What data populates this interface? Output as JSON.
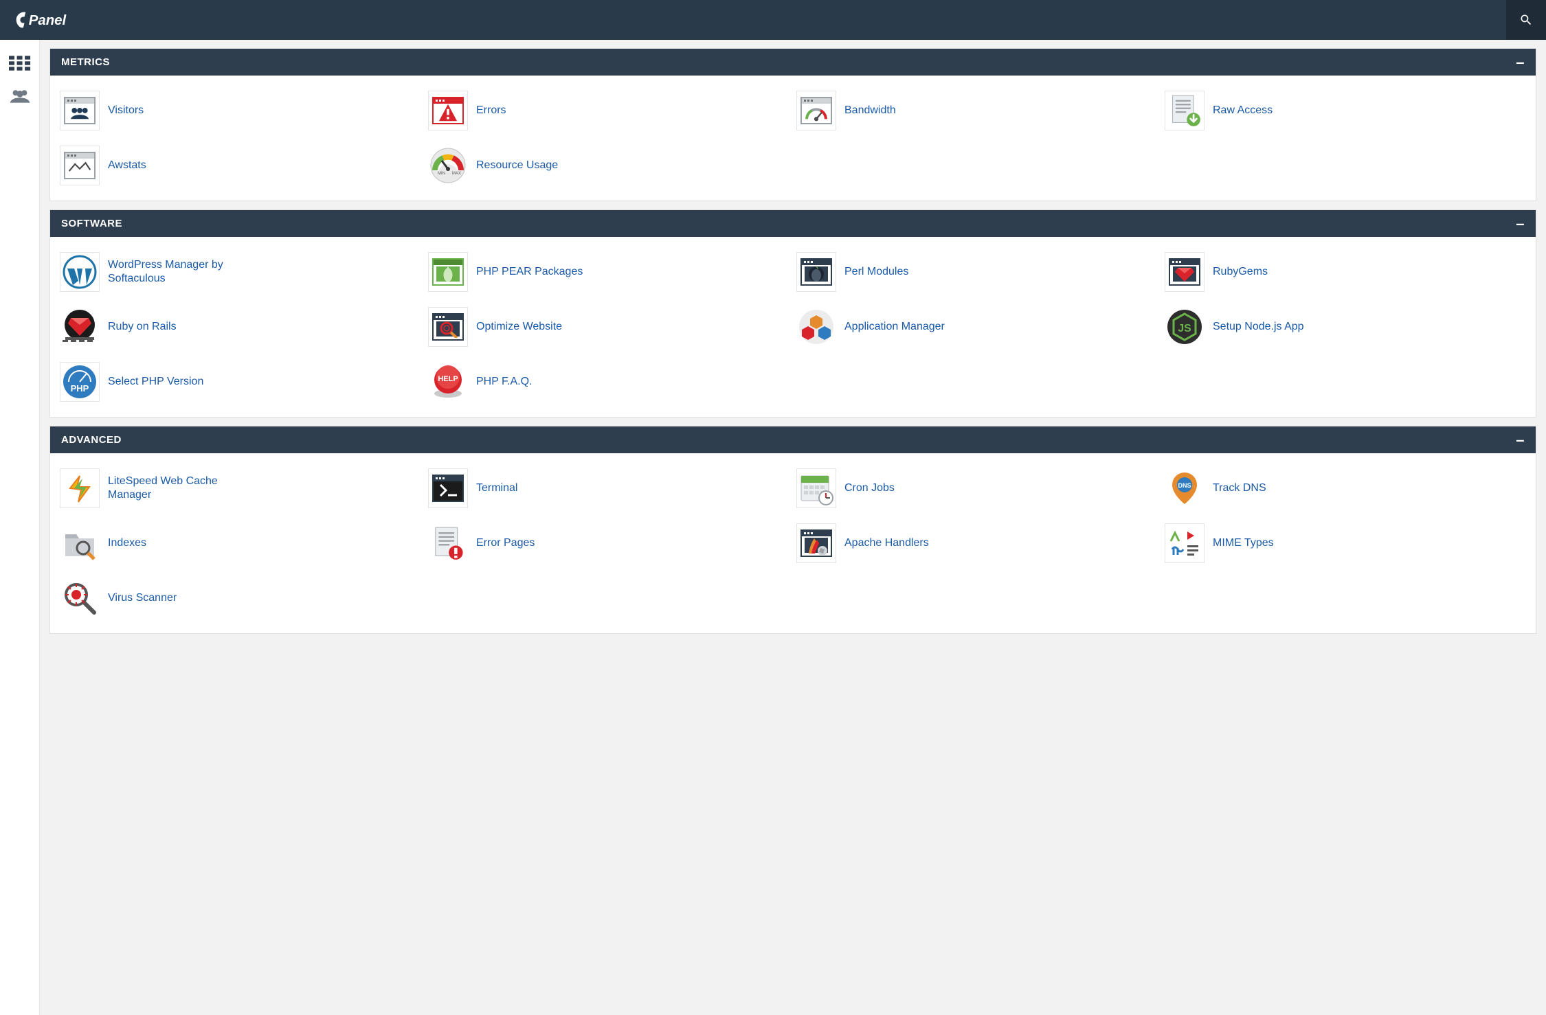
{
  "brand": "cPanel",
  "panels": [
    {
      "id": "metrics",
      "title": "METRICS",
      "items": [
        {
          "id": "visitors",
          "label": "Visitors",
          "icon": "visitors-icon"
        },
        {
          "id": "errors",
          "label": "Errors",
          "icon": "errors-icon"
        },
        {
          "id": "bandwidth",
          "label": "Bandwidth",
          "icon": "bandwidth-icon"
        },
        {
          "id": "raw-access",
          "label": "Raw Access",
          "icon": "raw-access-icon"
        },
        {
          "id": "awstats",
          "label": "Awstats",
          "icon": "awstats-icon"
        },
        {
          "id": "resource-usage",
          "label": "Resource Usage",
          "icon": "resource-usage-icon"
        }
      ]
    },
    {
      "id": "software",
      "title": "SOFTWARE",
      "items": [
        {
          "id": "wordpress-manager",
          "label": "WordPress Manager by Softaculous",
          "icon": "wordpress-icon"
        },
        {
          "id": "php-pear",
          "label": "PHP PEAR Packages",
          "icon": "php-pear-icon"
        },
        {
          "id": "perl-modules",
          "label": "Perl Modules",
          "icon": "perl-icon"
        },
        {
          "id": "rubygems",
          "label": "RubyGems",
          "icon": "rubygems-icon"
        },
        {
          "id": "ruby-on-rails",
          "label": "Ruby on Rails",
          "icon": "ruby-on-rails-icon"
        },
        {
          "id": "optimize-website",
          "label": "Optimize Website",
          "icon": "optimize-website-icon"
        },
        {
          "id": "application-manager",
          "label": "Application Manager",
          "icon": "application-manager-icon"
        },
        {
          "id": "setup-nodejs",
          "label": "Setup Node.js App",
          "icon": "nodejs-icon"
        },
        {
          "id": "select-php-version",
          "label": "Select PHP Version",
          "icon": "php-version-icon"
        },
        {
          "id": "php-faq",
          "label": "PHP F.A.Q.",
          "icon": "php-faq-icon"
        }
      ]
    },
    {
      "id": "advanced",
      "title": "ADVANCED",
      "items": [
        {
          "id": "litespeed",
          "label": "LiteSpeed Web Cache Manager",
          "icon": "litespeed-icon"
        },
        {
          "id": "terminal",
          "label": "Terminal",
          "icon": "terminal-icon"
        },
        {
          "id": "cron-jobs",
          "label": "Cron Jobs",
          "icon": "cron-jobs-icon"
        },
        {
          "id": "track-dns",
          "label": "Track DNS",
          "icon": "track-dns-icon"
        },
        {
          "id": "indexes",
          "label": "Indexes",
          "icon": "indexes-icon"
        },
        {
          "id": "error-pages",
          "label": "Error Pages",
          "icon": "error-pages-icon"
        },
        {
          "id": "apache-handlers",
          "label": "Apache Handlers",
          "icon": "apache-handlers-icon"
        },
        {
          "id": "mime-types",
          "label": "MIME Types",
          "icon": "mime-types-icon"
        },
        {
          "id": "virus-scanner",
          "label": "Virus Scanner",
          "icon": "virus-scanner-icon"
        }
      ]
    }
  ]
}
